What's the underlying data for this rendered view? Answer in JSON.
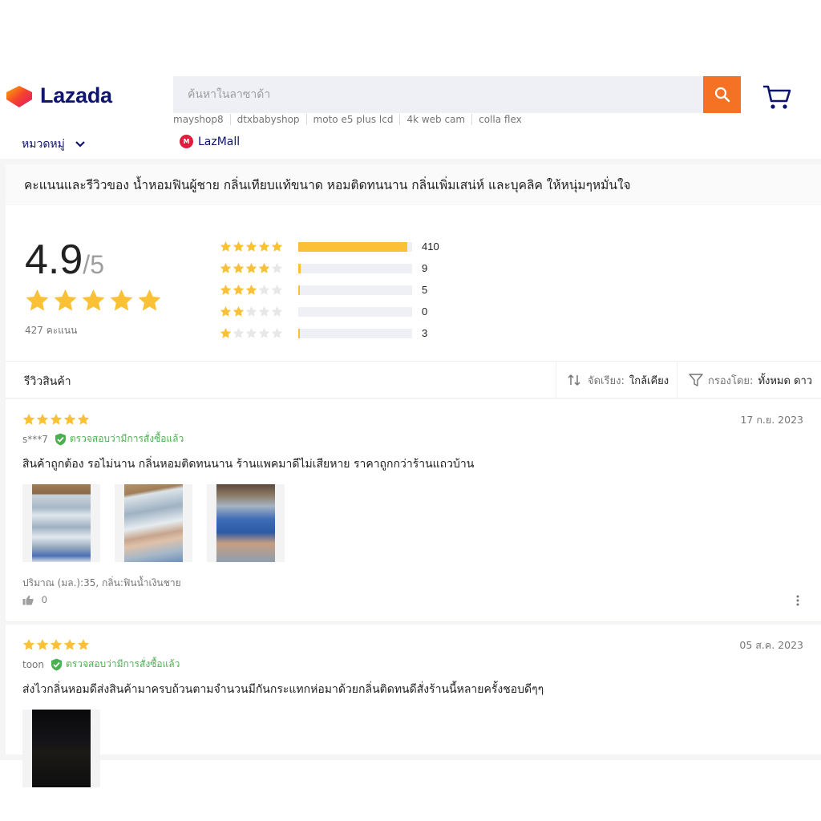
{
  "header": {
    "brand": "Lazada",
    "search_placeholder": "ค้นหาในลาซาด้า",
    "suggestions": [
      "mayshop8",
      "dtxbabyshop",
      "moto e5 plus lcd",
      "4k web cam",
      "colla flex"
    ],
    "category_label": "หมวดหมู่",
    "lazmall_label": "LazMall",
    "accent_color": "#f57224"
  },
  "ratings": {
    "title": "คะแนนและรีวิวของ น้ำหอมฟินผู้ชาย กลิ่นเทียบแท้ขนาด หอมติดทนนาน กลิ่นเพิ่มเสน่ห์ และบุคลิค ให้หนุ่มๆหมั่นใจ",
    "average": "4.9",
    "out_of": "/5",
    "average_stars": 5,
    "count_label": "427 คะแนน",
    "distribution": [
      {
        "stars": 5,
        "count": 410,
        "fraction": 0.96
      },
      {
        "stars": 4,
        "count": 9,
        "fraction": 0.02
      },
      {
        "stars": 3,
        "count": 5,
        "fraction": 0.012
      },
      {
        "stars": 2,
        "count": 0,
        "fraction": 0.0
      },
      {
        "stars": 1,
        "count": 3,
        "fraction": 0.007
      }
    ],
    "star_color": "#fac137"
  },
  "reviews_header": {
    "label": "รีวิวสินค้า",
    "sort_label": "จัดเรียง:",
    "sort_value": "ใกล้เคียง",
    "filter_label": "กรองโดย:",
    "filter_value": "ทั้งหมด ดาว"
  },
  "reviews": [
    {
      "stars": 5,
      "date": "17 ก.ย. 2023",
      "user": "s***7",
      "verified_label": "ตรวจสอบว่ามีการสั่งซื้อแล้ว",
      "text": "สินค้าถูกต้อง รอไม่นาน กลิ่นหอมติดทนนาน ร้านแพคมาดีไม่เสียหาย ราคาถูกกว่าร้านแถวบ้าน",
      "sku": "ปริมาณ (มล.):35, กลิ่น:ฟินน้ำเงินชาย",
      "likes": "0"
    },
    {
      "stars": 5,
      "date": "05 ส.ค. 2023",
      "user": "toon",
      "verified_label": "ตรวจสอบว่ามีการสั่งซื้อแล้ว",
      "text": "ส่งไวกลิ่นหอมดีส่งสินค้ามาครบถ้วนตามจำนวนมีกันกระแทกห่อมาด้วยกลิ่นติดทนดีสั่งร้านนี้หลายครั้งชอบดีๆๆ"
    }
  ]
}
